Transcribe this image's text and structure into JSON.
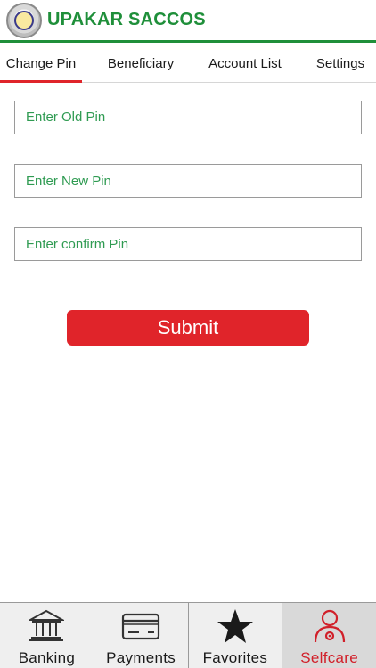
{
  "header": {
    "title": "UPAKAR SACCOS"
  },
  "tabs": [
    {
      "label": "Change Pin",
      "active": true
    },
    {
      "label": "Beneficiary",
      "active": false
    },
    {
      "label": "Account List",
      "active": false
    },
    {
      "label": "Settings",
      "active": false
    }
  ],
  "form": {
    "old_pin_placeholder": "Enter Old Pin",
    "new_pin_placeholder": "Enter New Pin",
    "confirm_pin_placeholder": "Enter confirm Pin",
    "submit_label": "Submit"
  },
  "bottom_nav": [
    {
      "label": "Banking",
      "icon": "bank-icon",
      "active": false
    },
    {
      "label": "Payments",
      "icon": "card-icon",
      "active": false
    },
    {
      "label": "Favorites",
      "icon": "star-icon",
      "active": false
    },
    {
      "label": "Selfcare",
      "icon": "user-settings-icon",
      "active": true
    }
  ],
  "colors": {
    "brand_green": "#1f8f3a",
    "accent_red": "#e0242a"
  }
}
